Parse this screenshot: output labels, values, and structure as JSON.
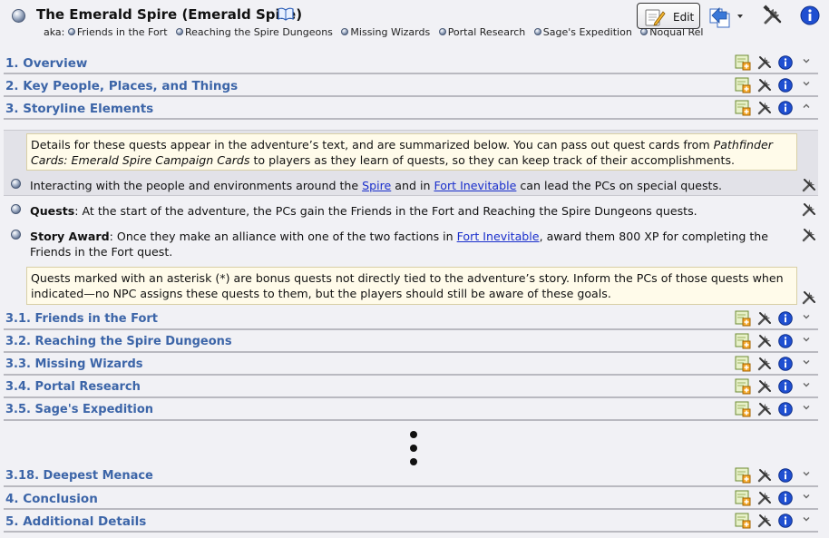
{
  "header": {
    "title": "The Emerald Spire (Emerald Spire)",
    "aka_label": "aka:",
    "aka_items": [
      "Friends in the Fort",
      "Reaching the Spire Dungeons",
      "Missing Wizards",
      "Portal Research",
      "Sage's Expedition",
      "Noqual Rel"
    ],
    "edit_label": "Edit"
  },
  "sections": {
    "overview": "1. Overview",
    "key_people": "2. Key People, Places, and Things",
    "storyline": "3. Storyline Elements",
    "friends": "3.1. Friends in the Fort",
    "reaching": "3.2. Reaching the Spire Dungeons",
    "missing": "3.3. Missing Wizards",
    "portal": "3.4. Portal Research",
    "sage": "3.5. Sage's Expedition",
    "deepest": "3.18. Deepest Menace",
    "conclusion": "4. Conclusion",
    "additional": "5. Additional Details"
  },
  "storyline": {
    "callout1_pre": "Details for these quests appear in the adventure’s text, and are summarized below. You can pass out quest cards from ",
    "callout1_italic": "Pathfinder Cards: Emerald Spire Campaign Cards",
    "callout1_post": " to players as they learn of quests, so they can keep track of their accomplishments.",
    "bullet1_pre": "Interacting with the people and environments around the ",
    "bullet1_link1": "Spire",
    "bullet1_mid": " and in ",
    "bullet1_link2": "Fort Inevitable",
    "bullet1_post": " can lead the PCs on special quests.",
    "bullet2_bold": "Quests",
    "bullet2_text": ": At the start of the adventure, the PCs gain the Friends in the Fort and Reaching the Spire Dungeons quests.",
    "bullet3_bold": "Story Award",
    "bullet3_pre": ": Once they make an alliance with one of the two factions in ",
    "bullet3_link": "Fort Inevitable",
    "bullet3_post": ", award them 800 XP for completing the Friends in the Fort quest.",
    "callout2": "Quests marked with an asterisk (*) are bonus quests not directly tied to the adventure’s story. Inform the PCs of those quests when indicated—no NPC assigns these quests to them, but the players should still be aware of these goals."
  },
  "icons": {
    "add": "add-section-icon",
    "tools": "tools-icon",
    "info": "info-icon",
    "chevron_down": "chevron-down-icon",
    "chevron_up": "chevron-up-icon"
  },
  "colors": {
    "section_title": "#3c65a8",
    "link": "#1a2fcc",
    "callout_bg": "#fffbea",
    "info_blue": "#1f4fd1"
  }
}
